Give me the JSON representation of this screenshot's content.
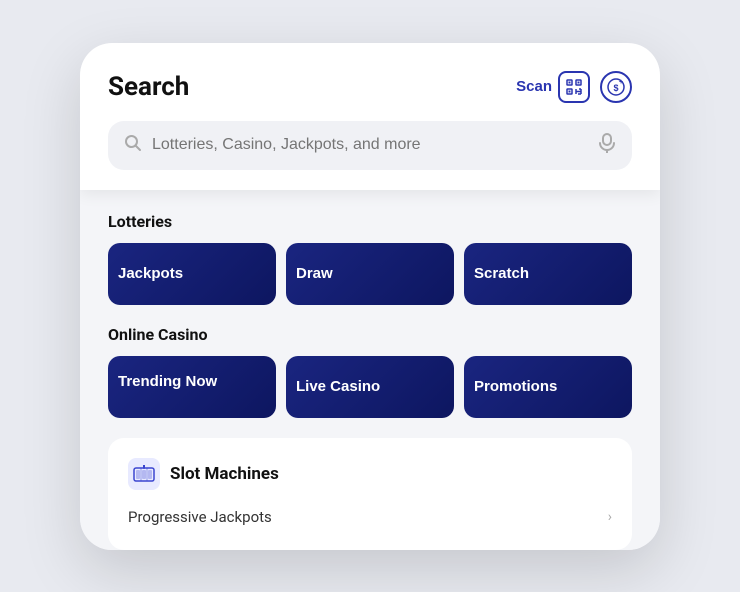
{
  "header": {
    "title": "Search",
    "scan_label": "Scan",
    "search_placeholder": "Lotteries, Casino, Jackpots, and more"
  },
  "lotteries": {
    "section_title": "Lotteries",
    "buttons": [
      {
        "label": "Jackpots"
      },
      {
        "label": "Draw"
      },
      {
        "label": "Scratch"
      }
    ]
  },
  "online_casino": {
    "section_title": "Online Casino",
    "buttons": [
      {
        "label": "Trending Now",
        "multiline": true
      },
      {
        "label": "Live Casino"
      },
      {
        "label": "Promotions"
      }
    ]
  },
  "slot_machines": {
    "section_title": "Slot Machines",
    "items": [
      {
        "label": "Progressive Jackpots"
      }
    ]
  },
  "icons": {
    "search": "🔍",
    "mic": "🎤",
    "qr": "⠿",
    "coin": "$+",
    "slot": "🎰",
    "chevron": "›"
  }
}
